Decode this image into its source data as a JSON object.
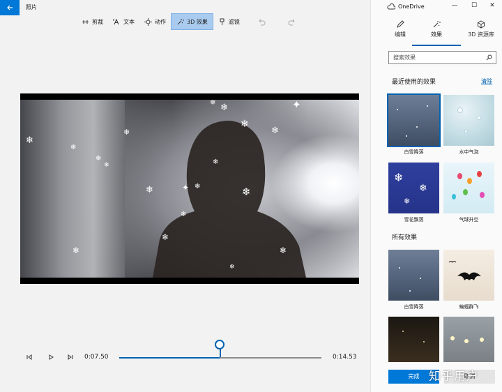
{
  "app": {
    "title": "照片"
  },
  "toolbar": {
    "trim": "剪裁",
    "text": "文本",
    "motion": "动作",
    "effects": "3D 效果",
    "filters": "滤镜"
  },
  "playback": {
    "current_time": "0:07.50",
    "total_time": "0:14.53",
    "progress": 0.498
  },
  "panel": {
    "onedrive": "OneDrive",
    "tabs": [
      {
        "label": "编辑",
        "icon": "pencil-icon"
      },
      {
        "label": "效果",
        "icon": "effects-sparkle-icon"
      },
      {
        "label": "3D 资源库",
        "icon": "cube-icon"
      }
    ],
    "search_placeholder": "搜索效果",
    "recent_title": "最近使用的效果",
    "clear_label": "清除",
    "recent": [
      {
        "label": "白雪降落",
        "selected": true
      },
      {
        "label": "水中气泡",
        "selected": false
      },
      {
        "label": "雪花飘落",
        "selected": false
      },
      {
        "label": "气球升空",
        "selected": false
      }
    ],
    "all_title": "所有效果",
    "all": [
      {
        "label": "白雪降落"
      },
      {
        "label": "蝙蝠群飞"
      }
    ],
    "done_label": "完成",
    "cancel_label": "取消"
  },
  "watermark": "知乎用户",
  "colors": {
    "accent": "#0078d7",
    "selected_tool": "#a9cbef"
  }
}
